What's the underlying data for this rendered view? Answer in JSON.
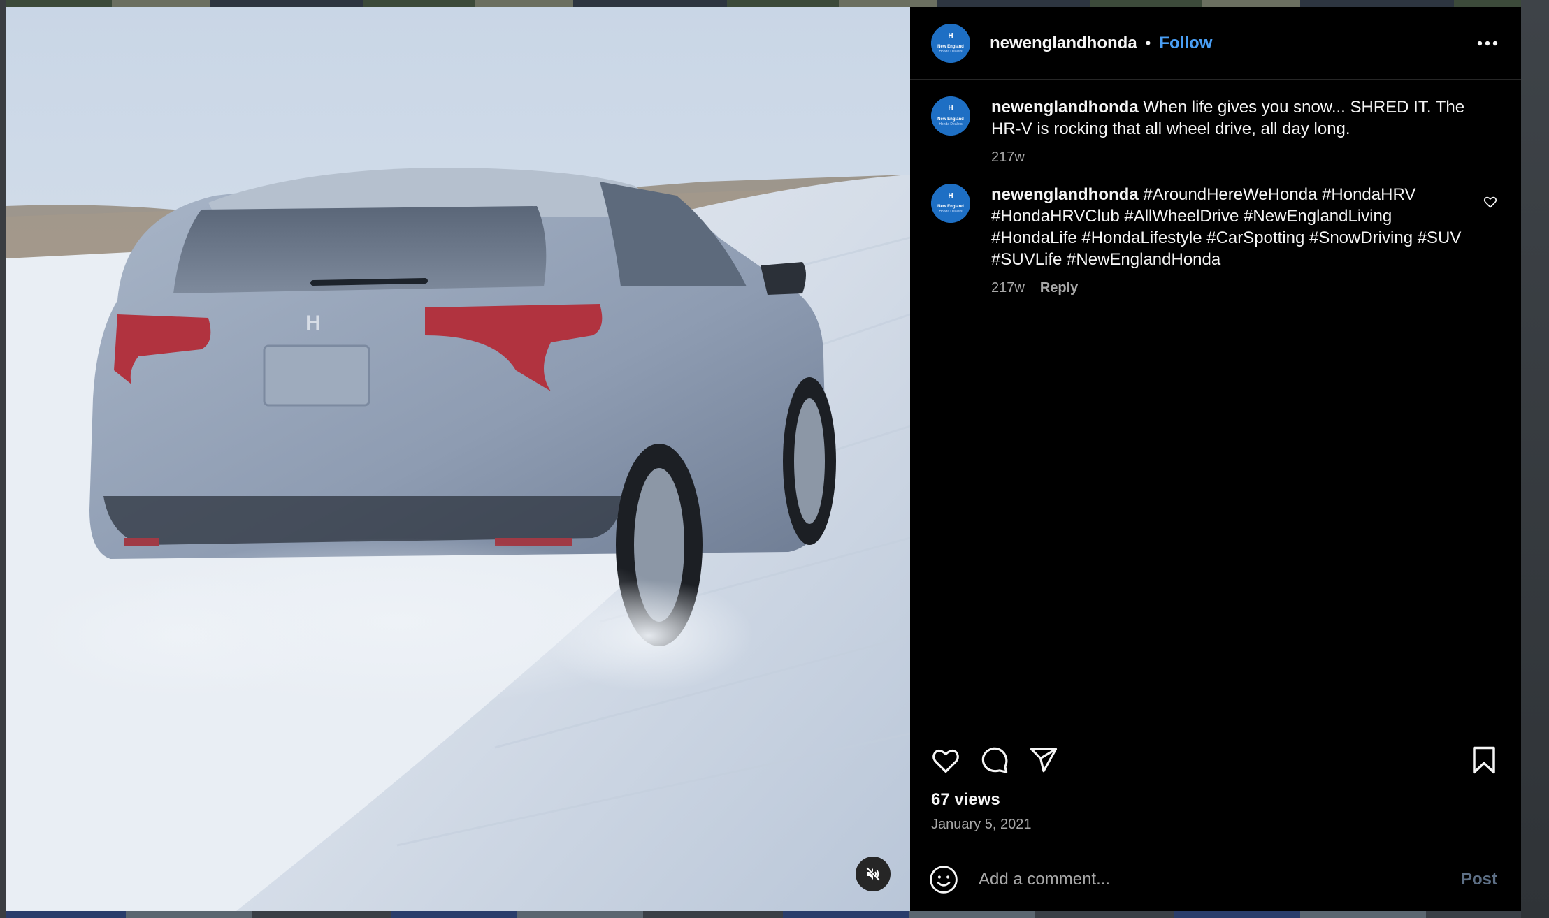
{
  "post": {
    "username": "newenglandhonda",
    "follow_label": "Follow",
    "separator": "•",
    "avatar_text_top": "H",
    "avatar_text_line1": "New England",
    "avatar_text_line2": "Honda Dealers"
  },
  "comments": [
    {
      "username": "newenglandhonda",
      "text": "When life gives you snow... SHRED IT. The HR-V is rocking that all wheel drive, all day long.",
      "age": "217w",
      "reply_label": ""
    },
    {
      "username": "newenglandhonda",
      "text": "#AroundHereWeHonda #HondaHRV #HondaHRVClub #AllWheelDrive #NewEnglandLiving #HondaLife #HondaLifestyle #CarSpotting #SnowDriving #SUV #SUVLife #NewEnglandHonda",
      "age": "217w",
      "reply_label": "Reply"
    }
  ],
  "stats": {
    "views": "67 views",
    "date": "January 5, 2021"
  },
  "composer": {
    "placeholder": "Add a comment...",
    "post_label": "Post"
  },
  "colors": {
    "accent": "#4a9ff5",
    "panel_bg": "#000000",
    "muted_text": "#a8a8a8",
    "avatar_bg": "#1e6fc4"
  },
  "icons": {
    "like": "heart-icon",
    "comment": "comment-bubble-icon",
    "share": "paper-plane-icon",
    "save": "bookmark-icon",
    "more": "more-horizontal-icon",
    "mute": "speaker-muted-icon",
    "emoji": "smiley-icon"
  }
}
